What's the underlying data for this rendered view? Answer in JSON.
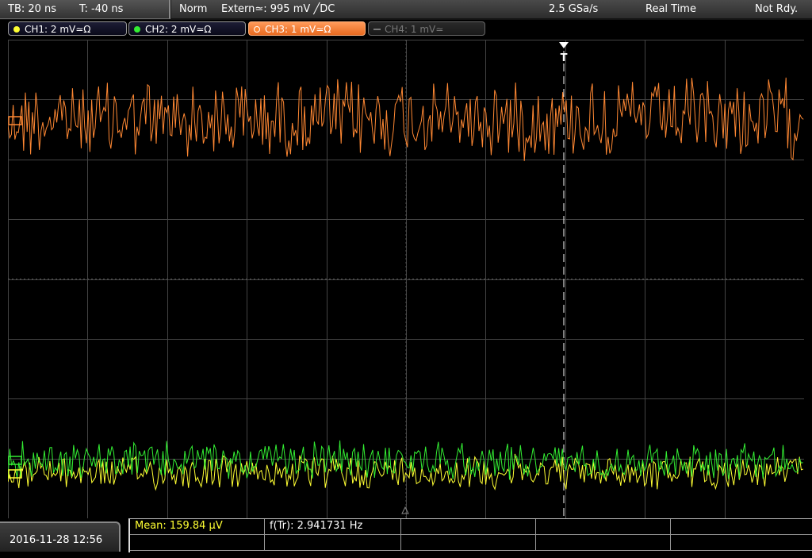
{
  "status_bar": {
    "timebase": "TB: 20 ns",
    "time_offset": "T: -40 ns",
    "trigger_mode": "Norm",
    "trigger_source": "Extern≃: 995 mV ╱DC",
    "sample_rate": "2.5 GSa/s",
    "acquisition_mode": "Real Time",
    "state": "Not Rdy."
  },
  "channels": [
    {
      "label": "CH1: 2 mV≃Ω",
      "color": "#ffff33",
      "state": "on"
    },
    {
      "label": "CH2: 2 mV≃Ω",
      "color": "#33ee33",
      "state": "on"
    },
    {
      "label": "CH3: 1 mV≃Ω",
      "color": "#ff8833",
      "state": "selected"
    },
    {
      "label": "CH4: 1 mV≃",
      "color": "#777777",
      "state": "off"
    }
  ],
  "trigger_marker": "T",
  "date_time": "2016-11-28 12:56",
  "measurements": {
    "mean": "Mean: 159.84 µV",
    "freq": "f(Tr): 2.941731 Hz"
  },
  "colors": {
    "ch1": "#ffff33",
    "ch2": "#33ee33",
    "ch3": "#ff8833",
    "grid": "#444444"
  }
}
